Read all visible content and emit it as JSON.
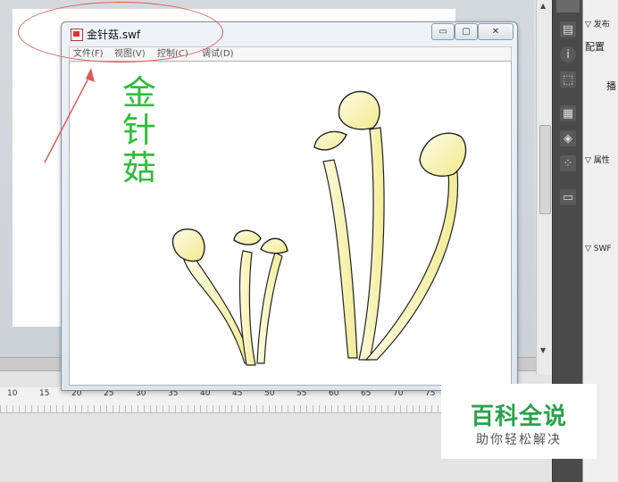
{
  "window": {
    "title": "金针菇.swf",
    "min_glyph": "▭",
    "max_glyph": "▢",
    "close_glyph": "✕"
  },
  "menu": [
    {
      "label": "文件(F)"
    },
    {
      "label": "视图(V)"
    },
    {
      "label": "控制(C)"
    },
    {
      "label": "调试(D)"
    }
  ],
  "artwork": {
    "title_chars": [
      "金",
      "针",
      "菇"
    ],
    "text_color": "#2fbe3c",
    "mushroom_fill": "#fbf7c4",
    "mushroom_stroke": "#222222"
  },
  "ruler": {
    "labels": [
      "10",
      "15",
      "20",
      "25",
      "30",
      "35",
      "40",
      "45",
      "50",
      "55",
      "60",
      "65",
      "70",
      "75"
    ]
  },
  "properties": {
    "section_publish": "▽ 发布",
    "config_label": "配置",
    "player_label": "播",
    "section_properties": "▽ 属性",
    "section_swf": "▽ SWF"
  },
  "tools": {
    "icons": [
      "align-icon",
      "info-icon",
      "transform-icon",
      "library-icon",
      "components-icon",
      "motion-icon",
      "swatches-icon"
    ]
  },
  "watermark": {
    "brand": "百科全说",
    "slogan": "助你轻松解决",
    "brand_color": "#2aa24a"
  },
  "annotation": {
    "color": "#e05a5a"
  }
}
